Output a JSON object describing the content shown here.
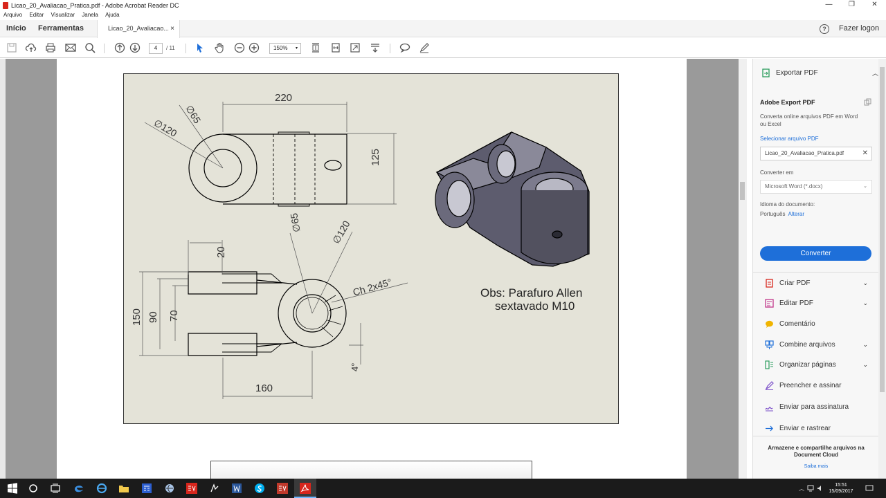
{
  "window": {
    "title": "Licao_20_Avaliacao_Pratica.pdf - Adobe Acrobat Reader DC",
    "controls": [
      "—",
      "❐",
      "✕"
    ]
  },
  "menu": [
    "Arquivo",
    "Editar",
    "Visualizar",
    "Janela",
    "Ajuda"
  ],
  "nav": {
    "home": "Início",
    "tools": "Ferramentas",
    "doc_tab": "Licao_20_Avaliacao...",
    "close": "×",
    "login": "Fazer logon",
    "help": "?"
  },
  "toolbar": {
    "page_current": "4",
    "page_total": "/ 11",
    "zoom": "150%",
    "zoom_arrow": "▾"
  },
  "drawing": {
    "dims": {
      "d220": "220",
      "d125": "125",
      "phi120_top": "∅120",
      "phi65_top": "∅65",
      "d20": "20",
      "phi65_bot": "∅65",
      "phi120_bot": "∅120",
      "chamfer": "Ch 2x45°",
      "d150": "150",
      "d90": "90",
      "d70": "70",
      "d160": "160",
      "d4": "4°"
    },
    "note_line1": "Obs: Parafuro Allen",
    "note_line2": "sextavado M10"
  },
  "panel": {
    "export_header": "Exportar PDF",
    "title": "Adobe Export PDF",
    "desc": "Converta online arquivos PDF em Word ou Excel",
    "select_link": "Selecionar arquivo PDF",
    "file_name": "Licao_20_Avaliacao_Pratica.pdf",
    "convert_to_label": "Converter em",
    "convert_to_value": "Microsoft Word (*.docx)",
    "lang_label": "Idioma do documento:",
    "lang_value": "Português",
    "lang_change": "Alterar",
    "convert_button": "Converter",
    "tools": [
      {
        "label": "Criar PDF",
        "chev": "⌄"
      },
      {
        "label": "Editar PDF",
        "chev": "⌄"
      },
      {
        "label": "Comentário",
        "chev": ""
      },
      {
        "label": "Combine arquivos",
        "chev": "⌄"
      },
      {
        "label": "Organizar páginas",
        "chev": "⌄"
      },
      {
        "label": "Preencher e assinar",
        "chev": ""
      },
      {
        "label": "Enviar para assinatura",
        "chev": ""
      },
      {
        "label": "Enviar e rastrear",
        "chev": ""
      }
    ],
    "promo": "Armazene e compartilhe arquivos na Document Cloud",
    "promo_link": "Saiba mais"
  },
  "taskbar": {
    "time": "15:51",
    "date": "15/09/2017"
  },
  "colors": {
    "accent": "#1e6fd9",
    "drawing_bg": "#e4e3d8",
    "pdf_red": "#d8261c"
  }
}
